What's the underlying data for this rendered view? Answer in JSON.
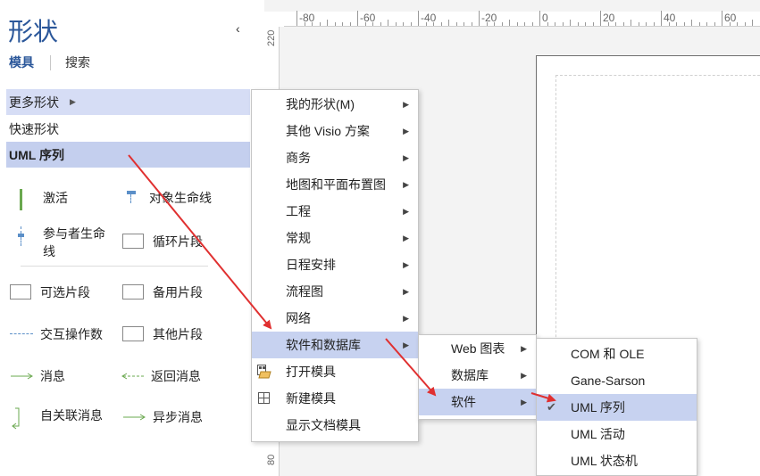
{
  "pane": {
    "title": "形状",
    "collapse_glyph": "‹",
    "tabs": [
      "模具",
      "搜索"
    ],
    "nav": {
      "more_shapes": "更多形状",
      "quick_shapes": "快速形状",
      "uml_sequence": "UML 序列"
    },
    "stencil": [
      {
        "label": "激活",
        "icon": "activation-icon"
      },
      {
        "label": "对象生命线",
        "icon": "object-lifeline-icon"
      },
      {
        "label": "参与者生命线",
        "icon": "actor-lifeline-icon"
      },
      {
        "label": "循环片段",
        "icon": "loop-fragment-icon"
      },
      {
        "label": "可选片段",
        "icon": "optional-fragment-icon"
      },
      {
        "label": "备用片段",
        "icon": "alternative-fragment-icon"
      },
      {
        "label": "交互操作数",
        "icon": "interaction-operand-icon"
      },
      {
        "label": "其他片段",
        "icon": "other-fragment-icon"
      },
      {
        "label": "消息",
        "icon": "message-icon"
      },
      {
        "label": "返回消息",
        "icon": "return-message-icon"
      },
      {
        "label": "自关联消息",
        "icon": "self-message-icon"
      },
      {
        "label": "异步消息",
        "icon": "async-message-icon"
      }
    ]
  },
  "ruler": {
    "horizontal": [
      "-80",
      "-60",
      "-40",
      "-20",
      "0",
      "20",
      "40",
      "60"
    ],
    "vertical": [
      "220",
      "80"
    ]
  },
  "menus": {
    "more_shapes": [
      {
        "label": "我的形状(M)",
        "submenu": true
      },
      {
        "label": "其他 Visio 方案",
        "submenu": true
      },
      {
        "label": "商务",
        "submenu": true
      },
      {
        "label": "地图和平面布置图",
        "submenu": true
      },
      {
        "label": "工程",
        "submenu": true
      },
      {
        "label": "常规",
        "submenu": true
      },
      {
        "label": "日程安排",
        "submenu": true
      },
      {
        "label": "流程图",
        "submenu": true
      },
      {
        "label": "网络",
        "submenu": true
      },
      {
        "label": "软件和数据库",
        "submenu": true,
        "highlighted": true
      },
      {
        "label": "打开模具",
        "submenu": false,
        "icon": "open-stencil-icon"
      },
      {
        "label": "新建模具",
        "submenu": false,
        "icon": "new-stencil-icon"
      },
      {
        "label": "显示文档模具",
        "submenu": false
      }
    ],
    "software_db": [
      {
        "label": "Web 图表",
        "submenu": true
      },
      {
        "label": "数据库",
        "submenu": true
      },
      {
        "label": "软件",
        "submenu": true,
        "highlighted": true
      }
    ],
    "software": [
      {
        "label": "COM 和 OLE"
      },
      {
        "label": "Gane-Sarson"
      },
      {
        "label": "UML 序列",
        "checked": true,
        "highlighted": true
      },
      {
        "label": "UML 活动"
      },
      {
        "label": "UML 状态机"
      }
    ]
  },
  "colors": {
    "accent": "#2b579a",
    "highlight": "#c7d2f0",
    "arrow": "#e03030"
  }
}
